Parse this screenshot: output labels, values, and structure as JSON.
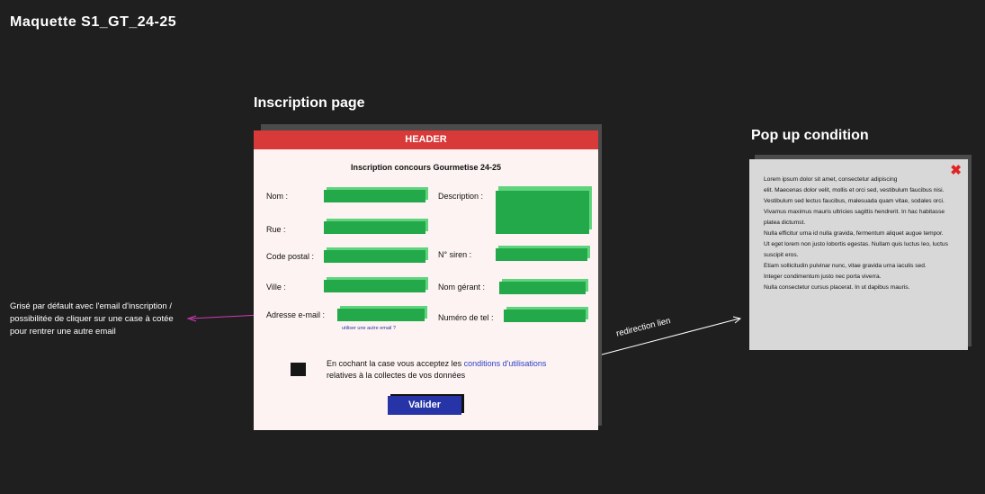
{
  "board": {
    "title": "Maquette S1_GT_24-25",
    "inscription_title": "Inscription page",
    "popup_title": "Pop up condition",
    "note": "Grisé par défault avec l'email d'inscription / possibilitée de cliquer sur une case à cotée pour rentrer une autre email",
    "redirect_label": "redirection lien"
  },
  "colors": {
    "background": "#1f1f1f",
    "header": "#d83a3a",
    "field": "#23a84a",
    "button": "#2634a8",
    "link": "#2f3fc9",
    "close": "#e02424"
  },
  "form": {
    "header": "HEADER",
    "title": "Inscription concours Gourmetise 24-25",
    "labels": {
      "nom": "Nom  :",
      "rue": "Rue :",
      "code_postal": "Code postal :",
      "ville": "Ville :",
      "email": "Adresse e-mail :",
      "description": "Description :",
      "siren": "N° siren :",
      "gerant": "Nom gérant  :",
      "tel": "Numéro de tel :"
    },
    "email_hint": "utiliser une autre email ?",
    "consent_before": "En cochant la case vous acceptez les ",
    "consent_link": "conditions d'utilisations",
    "consent_after": " relatives à la collectes de vos données",
    "submit": "Valider"
  },
  "popup": {
    "close_icon": "close-x-icon",
    "text": "Lorem ipsum dolor sit amet, consectetur adipiscing\nelit. Maecenas dolor velit, mollis et orci sed, vestibulum faucibus nisi.\n Vestibulum sed lectus faucibus, malesuada quam vitae, sodales orci.\nVivamus maximus mauris ultricies sagittis hendrerit. In hac habitasse platea dictumst.\nNulla efficitur urna id nulla gravida, fermentum aliquet augue tempor.\nUt eget lorem non justo lobortis egestas. Nullam quis luctus leo, luctus suscipit eros.\n Etiam sollicitudin pulvinar nunc, vitae gravida urna iaculis sed.\nInteger condimentum justo nec porta viverra.\nNulla consectetur cursus placerat. In ut dapibus mauris."
  }
}
